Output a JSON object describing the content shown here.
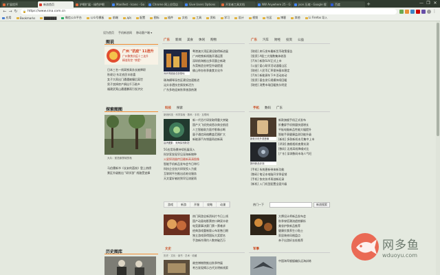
{
  "browser": {
    "tabs": [
      {
        "label": "扩展程序",
        "active": false
      },
      {
        "label": "新浪首页",
        "active": true
      },
      {
        "label": "护眼扩展 - 绿色护眼",
        "active": false
      },
      {
        "label": "Manifest - Icons - Go",
        "active": false
      },
      {
        "label": "Chrome 网上应用店",
        "active": false
      },
      {
        "label": "Give Users Options",
        "active": false
      },
      {
        "label": "开发者工具文档",
        "active": false
      },
      {
        "label": "NW Anywhere 25 - G",
        "active": false
      },
      {
        "label": "json 压缩 - Google 搜",
        "active": false
      },
      {
        "label": "百度",
        "active": false
      }
    ],
    "new_tab_label": "+",
    "window_controls": [
      "—",
      "❐",
      "✕"
    ],
    "nav": {
      "back": "←",
      "forward": "→",
      "reload": "↻"
    },
    "url": "https://www.sina.com.cn",
    "bookmarks": [
      "应用",
      "Bookmarks",
      "██████",
      "微信公众平台",
      "公众号模板",
      "前端",
      "API",
      "配置",
      "图标",
      "插件",
      "文档",
      "工具",
      "资料",
      "学习",
      "设计",
      "视频",
      "社区",
      "博客",
      "其他",
      "Li Firefox 导入"
    ]
  },
  "page": {
    "topnav": [
      "设为首页",
      "手机新浪网",
      "移动客户端 ▾"
    ],
    "left": {
      "section1_title": "图说",
      "ad_headline": "广州 \"抗疫\" 11连升",
      "ad_lines": [
        "广州聚焦抗疫十三连升",
        "精准防控 \"铁壁\""
      ],
      "list1": [
        "日本三名一线高铁乘务长被降职",
        "秋收记·东北农民丰收喜",
        "女子大雨出门遭遇被撞后离世",
        "男子卖掉房产捐出千万助乡",
        "福建武夷山遭遇暴雨引发洪灾"
      ],
      "section2_title": "探索图图",
      "caption": "大片：航拍紫禁城的秋",
      "list2": [
        "马伯庸新书《长安的荔枝》登上热榜",
        "景区升级推出 \"研学游\" 线路受追捧"
      ],
      "section3_title": "历史图库"
    },
    "center": {
      "block1": {
        "tabs": [
          "广东",
          "新闻",
          "美食",
          "休闲",
          "购物"
        ],
        "thumb_caption": "深圳湾超级总部基地",
        "lines": [
          "粤港澳大湾区建设取得新进展",
          "广州地铁新线路开通运营",
          "深圳前海推出多项惠企新政",
          "东莞制造业转型升级提速",
          "佛山举办秋季美食文化节",
          "珠海横琴深合区建设加速推进",
          "汕头非遗技艺焕发新活力",
          "广东多地迎来秋季旅游热潮"
        ]
      },
      "block2": {
        "tabs": [
          "科技",
          "探索"
        ],
        "links": "新浪科技 · 科学探索 · 数码 · 手机 · 互联网",
        "thumb_caption": "高清图集：深海探测新发现",
        "lines": [
          "新一代芯片研发取得重大突破",
          "国产大飞机完成首次商业航班",
          "人工智能助力医疗影像诊断",
          "量子通信网络覆盖范围扩大",
          "新能源汽车销量再创新高",
          "5G应用场景持续拓展深入",
          "科学家发现罕见深海新物种",
          "火星探测器传回最新高清图像",
          "智能手机新品发布会今日举行",
          "科技企业加大研发投入力度",
          "互联网平台推出适老化服务",
          "天文爱好者拍到罕见流星雨"
        ]
      },
      "mini_tabs": [
        "游戏",
        "新游",
        "开服",
        "攻略",
        "动漫"
      ],
      "block3": {
        "lines": [
          "热门网游全新资料片今日上线",
          "国产动画电影票房口碑双丰收",
          "电竞赛事决赛门票一票难求",
          "经典游戏重制版公布发售日期",
          "独立游戏获得国际大奖提名",
          "手游新作预约人数突破百万"
        ]
      },
      "block4": {
        "tabs": [
          "文史"
        ],
        "links": "历史 · 文化 · 读书 · 艺术 · 收藏",
        "lines": [
          "故宫博物院推出秋季特展",
          "考古发现揭示古代文明新线索"
        ]
      }
    },
    "right": {
      "block1": {
        "tabs": [
          "广东",
          "汽车",
          "财经",
          "投资",
          "公益"
        ],
        "lines": [
          "[财经] 央行发布最新货币政策报告",
          "[投资] A股三大指数集体收涨",
          "[汽车] 新款SUV正式上市",
          "[公益] 爱心助学活动温暖山区",
          "[财经] 人民币汇率保持基本稳定",
          "[汽车] 新能源车下乡活动启动",
          "[投资] 基金发行规模持续回暖",
          "[财经] 消费市场回暖势头明显"
        ]
      },
      "block2": {
        "tabs": [
          "手机",
          "数码",
          "广东"
        ],
        "thumb1_caption": "新款手机外观首曝",
        "thumb2_caption": "数码新品评测",
        "lines": [
          "新款旗舰手机正式发布",
          "折叠屏手机销量快速增长",
          "平板电脑新品性能大幅提升",
          "智能手表健康监测功能升级",
          "[新机] 多款新机本月集中上市",
          "[评测] 旗舰相机夜景实测",
          "[数码] 无线耳机降噪对比",
          "[广东] 深圳数码市场人气旺",
          "[手机] 系统更新带来新功能",
          "[数码] 笔记本电脑开学季促销",
          "[手机] 快充技术再创新纪录",
          "[新机] 入门机型配置全面升级"
        ]
      },
      "search": {
        "label": "热门一下",
        "placeholder": "",
        "button": "新浪搜索"
      },
      "block3": {
        "lines": [
          "大牌设计师新品发布会",
          "秋季穿搭潮流趋势解析",
          "美妆护肤新品推荐",
          "健康饮食养生小贴士",
          "家居装修风格盘点",
          "亲子出游好去处推荐"
        ]
      },
      "block4": {
        "tabs": [
          "军事"
        ],
        "lines": [
          "中国海军舰艇编队远海训练"
        ]
      }
    }
  },
  "watermark": {
    "cn": "网多鱼",
    "en": "wduoyu.com"
  },
  "colors": {
    "accent": "#f28c32",
    "link_red": "#c0392b",
    "bg": "#e4e9df",
    "chrome": "#2f3a2e"
  }
}
